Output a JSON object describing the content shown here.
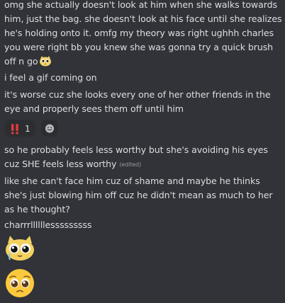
{
  "messages": [
    {
      "text": "omg she actually doesn't look at him when she walks towards him, just the bag. she doesn't look at his face until she realizes he's holding onto it. omfg my theory was right ughhh charles you were right bb you knew she was gonna try a quick brush off n go",
      "emoji": "crying-cat-emoji"
    },
    {
      "text": "i feel a gif coming on"
    },
    {
      "text": "it's worse cuz she looks every one of her other friends in the eye and properly sees them off until him"
    },
    {
      "text": "so he probably feels less worthy but she's avoiding his eyes cuz SHE feels less worthy",
      "edited": "(edited)"
    },
    {
      "text": "like she can't face him cuz of shame and maybe he thinks she's just blowing him off cuz he didn't mean as much to her as he thought?"
    },
    {
      "text": "charrrllllllesssssssss"
    }
  ],
  "reactions": [
    {
      "emoji": "double-exclamation-icon",
      "count": "1"
    }
  ],
  "add_reaction_icon": "add-reaction-smiley-icon",
  "big_emojis": [
    "crying-cat-emoji",
    "pleading-face-emoji"
  ],
  "colors": {
    "background": "#313338",
    "text": "#dbdee1",
    "muted": "#949ba4",
    "reaction_bg": "#2b2d31",
    "accent_red": "#e23b3b"
  }
}
